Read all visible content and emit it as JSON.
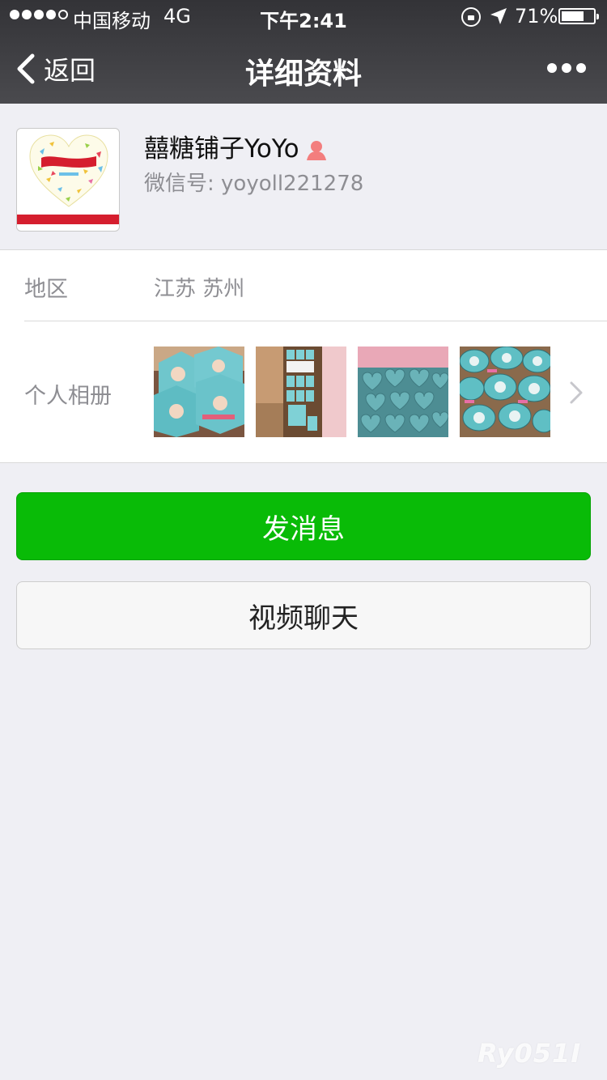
{
  "status_bar": {
    "carrier": "中国移动",
    "network": "4G",
    "time": "下午2:41",
    "battery_percent": "71%",
    "battery_level": 0.71,
    "signal_strength": 4,
    "icons": [
      "orientation-lock-icon",
      "location-arrow-icon",
      "battery-icon"
    ]
  },
  "nav": {
    "back_label": "返回",
    "title": "详细资料",
    "more_icon": "ellipsis-icon"
  },
  "profile": {
    "display_name": "囍糖铺子YoYo",
    "wechat_id": "微信号:  yoyoll221278",
    "gender_icon": "female-icon",
    "gender_color": "#f37e7e"
  },
  "info": {
    "region_label": "地区",
    "region_value": "江苏 苏州",
    "album_label": "个人相册"
  },
  "actions": {
    "send_message_label": "发消息",
    "video_chat_label": "视频聊天"
  },
  "colors": {
    "accent_green": "#09bb07",
    "nav_bar": "#3a3a3e",
    "page_background": "#efeff4"
  },
  "watermark": "Ry051I"
}
